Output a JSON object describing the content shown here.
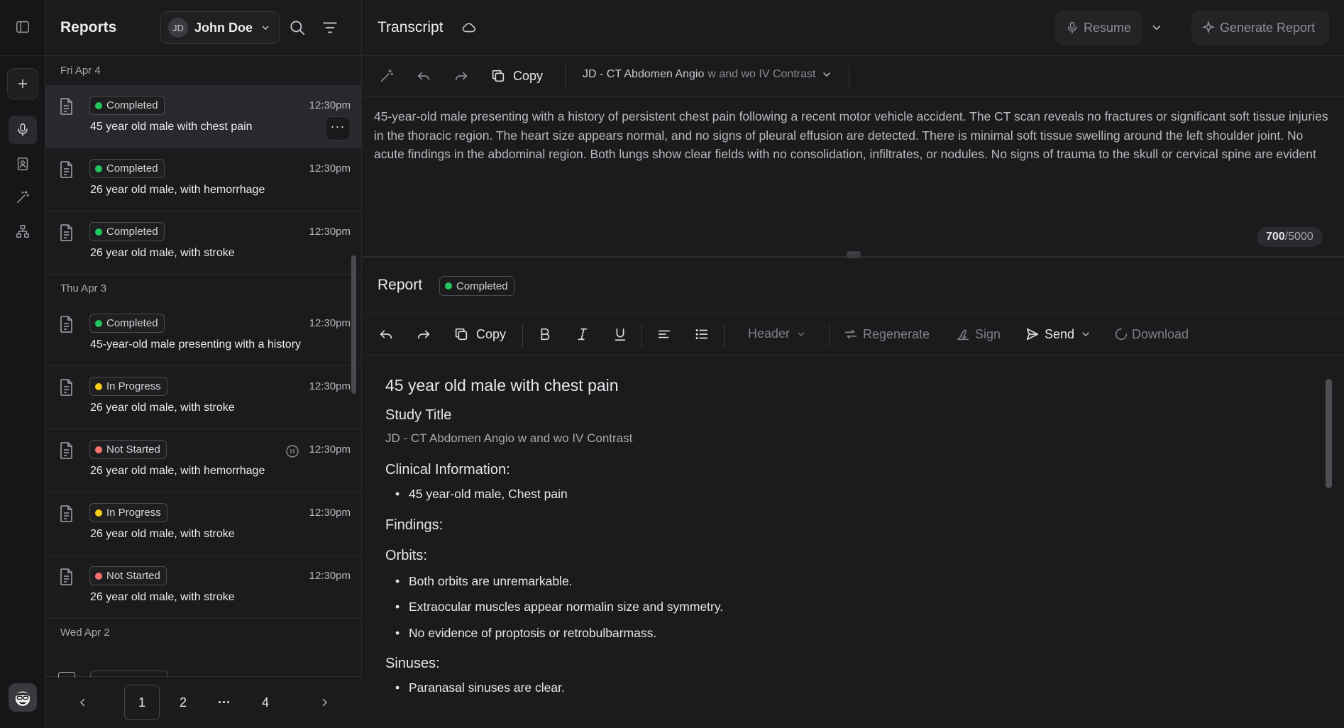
{
  "rail": {
    "items": [
      "sidebar-toggle",
      "new-report",
      "microphone",
      "contacts",
      "magic-wand",
      "org-chart"
    ],
    "active": "microphone"
  },
  "list_panel": {
    "title": "Reports",
    "user": {
      "initials": "JD",
      "name": "John Doe"
    },
    "groups": [
      {
        "date": "Fri Apr 4",
        "items": [
          {
            "status": "Completed",
            "status_color": "#22c55e",
            "time": "12:30pm",
            "title": "45 year old male with chest pain",
            "selected": true
          },
          {
            "status": "Completed",
            "status_color": "#22c55e",
            "time": "12:30pm",
            "title": "26 year old male, with hemorrhage"
          },
          {
            "status": "Completed",
            "status_color": "#22c55e",
            "time": "12:30pm",
            "title": "26 year old male, with stroke"
          }
        ]
      },
      {
        "date": "Thu Apr 3",
        "items": [
          {
            "status": "Completed",
            "status_color": "#22c55e",
            "time": "12:30pm",
            "title": "45-year-old male presenting with a history"
          },
          {
            "status": "In Progress",
            "status_color": "#facc15",
            "time": "12:30pm",
            "title": "26 year old male, with stroke"
          },
          {
            "status": "Not Started",
            "status_color": "#f87171",
            "time": "12:30pm",
            "title": "26 year old male, with hemorrhage",
            "paused": true
          },
          {
            "status": "In Progress",
            "status_color": "#facc15",
            "time": "12:30pm",
            "title": "26 year old male, with stroke"
          },
          {
            "status": "Not Started",
            "status_color": "#f87171",
            "time": "12:30pm",
            "title": "26 year old male, with stroke"
          }
        ]
      },
      {
        "date": "Wed Apr 2",
        "items": []
      }
    ],
    "more_label": "···",
    "pagination": {
      "pages": [
        "1",
        "2",
        "···",
        "4"
      ],
      "current": "1"
    }
  },
  "transcript": {
    "title": "Transcript",
    "resume_label": "Resume",
    "generate_label": "Generate Report",
    "copy_label": "Copy",
    "study_title_main": "JD - CT Abdomen Angio",
    "study_title_rest": "w and wo IV Contrast",
    "text": "45-year-old male presenting with a history of persistent chest pain following a recent motor vehicle accident. The CT scan reveals no fractures or significant soft tissue injuries in the thoracic region. The heart size appears normal, and no signs of pleural effusion are detected. There is minimal soft tissue swelling around the left shoulder joint. No acute findings in the abdominal region. Both lungs show clear fields with no consolidation, infiltrates, or nodules. No signs of trauma to the skull or cervical spine are evident",
    "char_count": "700",
    "char_limit": "/5000"
  },
  "report": {
    "title": "Report",
    "status": "Completed",
    "status_color": "#22c55e",
    "toolbar": {
      "copy": "Copy",
      "header": "Header",
      "regenerate": "Regenerate",
      "sign": "Sign",
      "send": "Send",
      "download": "Download"
    },
    "doc": {
      "heading": "45 year old male with chest pain",
      "study_title_label": "Study Title",
      "study_title_value": "JD - CT Abdomen Angio w and wo IV Contrast",
      "clinical_label": "Clinical Information:",
      "clinical_items": [
        "45 year-old male, Chest pain"
      ],
      "findings_label": "Findings:",
      "orbits_label": "Orbits:",
      "orbits_items": [
        "Both orbits are unremarkable.",
        "Extraocular muscles appear normalin size and symmetry.",
        "No evidence of proptosis or retrobulbarmass."
      ],
      "sinuses_label": "Sinuses:",
      "sinuses_items": [
        "Paranasal sinuses are clear."
      ]
    }
  }
}
